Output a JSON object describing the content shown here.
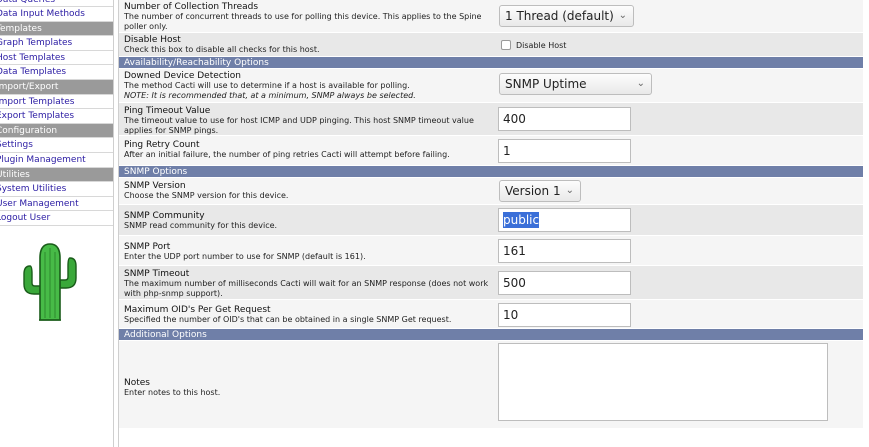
{
  "sidebar": {
    "items": [
      {
        "label": "Data Queries",
        "kind": "link",
        "cut": true
      },
      {
        "label": "Data Input Methods",
        "kind": "link"
      },
      {
        "label": "Templates",
        "kind": "head"
      },
      {
        "label": "Graph Templates",
        "kind": "link"
      },
      {
        "label": "Host Templates",
        "kind": "link"
      },
      {
        "label": "Data Templates",
        "kind": "link"
      },
      {
        "label": "Import/Export",
        "kind": "head"
      },
      {
        "label": "Import Templates",
        "kind": "link"
      },
      {
        "label": "Export Templates",
        "kind": "link"
      },
      {
        "label": "Configuration",
        "kind": "head"
      },
      {
        "label": "Settings",
        "kind": "link"
      },
      {
        "label": "Plugin Management",
        "kind": "link"
      },
      {
        "label": "Utilities",
        "kind": "head"
      },
      {
        "label": "System Utilities",
        "kind": "link"
      },
      {
        "label": "User Management",
        "kind": "link"
      },
      {
        "label": "Logout User",
        "kind": "link"
      }
    ],
    "logo_icon": "cactus-logo-icon"
  },
  "form": {
    "threads": {
      "title": "Number of Collection Threads",
      "desc": "The number of concurrent threads to use for polling this device. This applies to the Spine poller only.",
      "value": "1 Thread (default)"
    },
    "disable": {
      "title": "Disable Host",
      "desc": "Check this box to disable all checks for this host.",
      "checkbox_label": "Disable Host"
    },
    "section_availability": "Availability/Reachability Options",
    "downed": {
      "title": "Downed Device Detection",
      "desc": "The method Cacti will use to determine if a host is available for polling.",
      "note": "NOTE: It is recommended that, at a minimum, SNMP always be selected.",
      "value": "SNMP Uptime"
    },
    "ping_timeout": {
      "title": "Ping Timeout Value",
      "desc": "The timeout value to use for host ICMP and UDP pinging. This host SNMP timeout value applies for SNMP pings.",
      "value": "400"
    },
    "ping_retry": {
      "title": "Ping Retry Count",
      "desc": "After an initial failure, the number of ping retries Cacti will attempt before failing.",
      "value": "1"
    },
    "section_snmp": "SNMP Options",
    "snmp_version": {
      "title": "SNMP Version",
      "desc": "Choose the SNMP version for this device.",
      "value": "Version 1"
    },
    "snmp_community": {
      "title": "SNMP Community",
      "desc": "SNMP read community for this device.",
      "value": "public"
    },
    "snmp_port": {
      "title": "SNMP Port",
      "desc": "Enter the UDP port number to use for SNMP (default is 161).",
      "value": "161"
    },
    "snmp_timeout": {
      "title": "SNMP Timeout",
      "desc": "The maximum number of milliseconds Cacti will wait for an SNMP response (does not work with php-snmp support).",
      "value": "500"
    },
    "max_oids": {
      "title": "Maximum OID's Per Get Request",
      "desc": "Specified the number of OID's that can be obtained in a single SNMP Get request.",
      "value": "10"
    },
    "section_additional": "Additional Options",
    "notes": {
      "title": "Notes",
      "desc": "Enter notes to this host.",
      "value": ""
    }
  },
  "colors": {
    "section_header": "#6f7fa8",
    "sidebar_header": "#9a9a9a",
    "link": "#2a1ba3",
    "selection": "#3a6fd8"
  }
}
